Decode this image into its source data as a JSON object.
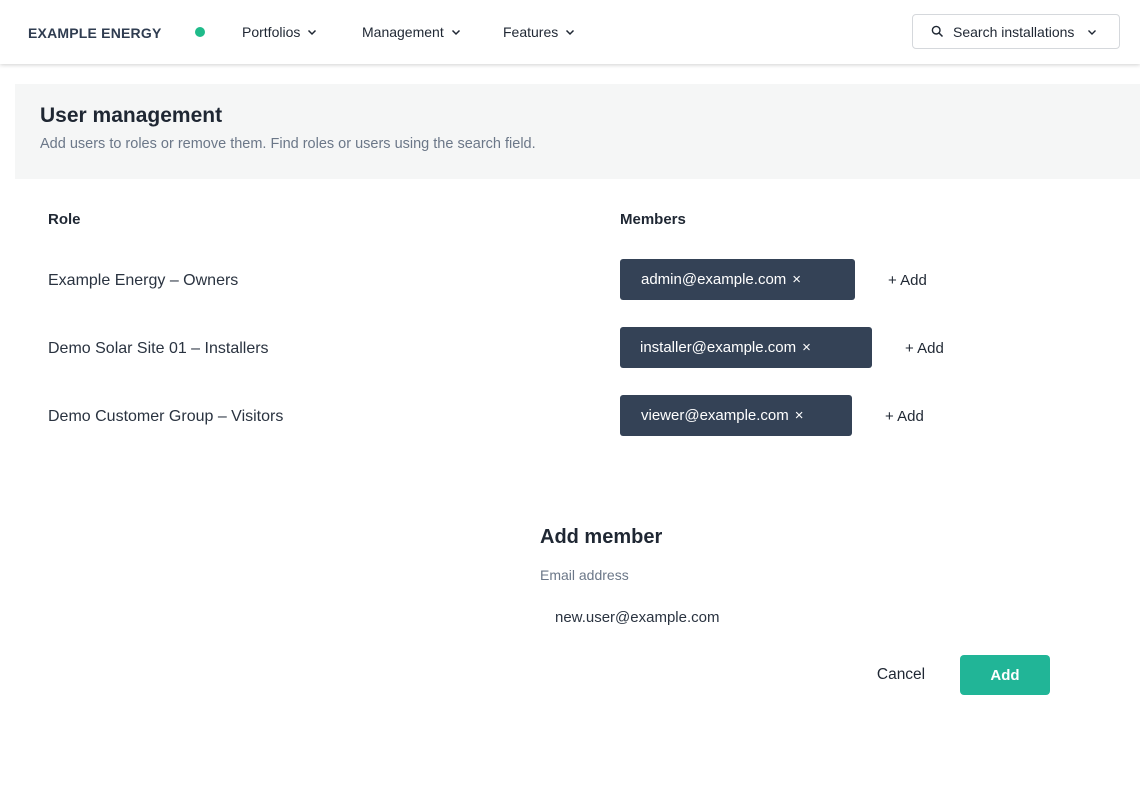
{
  "app": {
    "brand": "EXAMPLE ENERGY",
    "status_color": "#1fbb8a"
  },
  "nav": {
    "items": [
      {
        "label": "Portfolios"
      },
      {
        "label": "Management"
      },
      {
        "label": "Features"
      }
    ],
    "search_label": "Search installations"
  },
  "header": {
    "title": "User management",
    "subtitle": "Add users to roles or remove them. Find roles or users using the search field."
  },
  "table": {
    "role_header": "Role",
    "members_header": "Members",
    "rows": [
      {
        "role": "Example Energy – Owners",
        "member": "admin@example.com",
        "remove": "×",
        "add": "+ Add"
      },
      {
        "role": "Demo Solar Site 01 – Installers",
        "member": "installer@example.com",
        "remove": "×",
        "add": "+ Add"
      },
      {
        "role": "Demo Customer Group – Visitors",
        "member": "viewer@example.com",
        "remove": "×",
        "add": "+ Add"
      }
    ]
  },
  "add_member": {
    "title": "Add member",
    "email_label": "Email address",
    "email_value": "new.user@example.com",
    "cancel_label": "Cancel",
    "add_label": "Add"
  },
  "colors": {
    "accent": "#21b597",
    "chip": "#344256"
  }
}
